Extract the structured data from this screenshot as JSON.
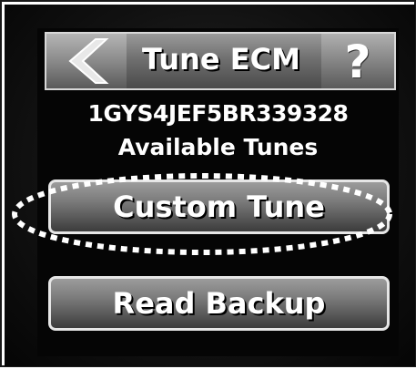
{
  "header": {
    "title": "Tune ECM",
    "back_icon": "chevron-left-icon",
    "help_label": "?"
  },
  "vehicle": {
    "vin": "1GYS4JEF5BR339328"
  },
  "section": {
    "subtitle": "Available Tunes"
  },
  "menu": {
    "items": [
      {
        "label": "Custom Tune"
      },
      {
        "label": "Read Backup"
      }
    ]
  },
  "colors": {
    "screen_bg": "#050505",
    "button_border": "#e6e6e6",
    "text": "#ffffff",
    "highlight_annotation": "#ffffff"
  }
}
